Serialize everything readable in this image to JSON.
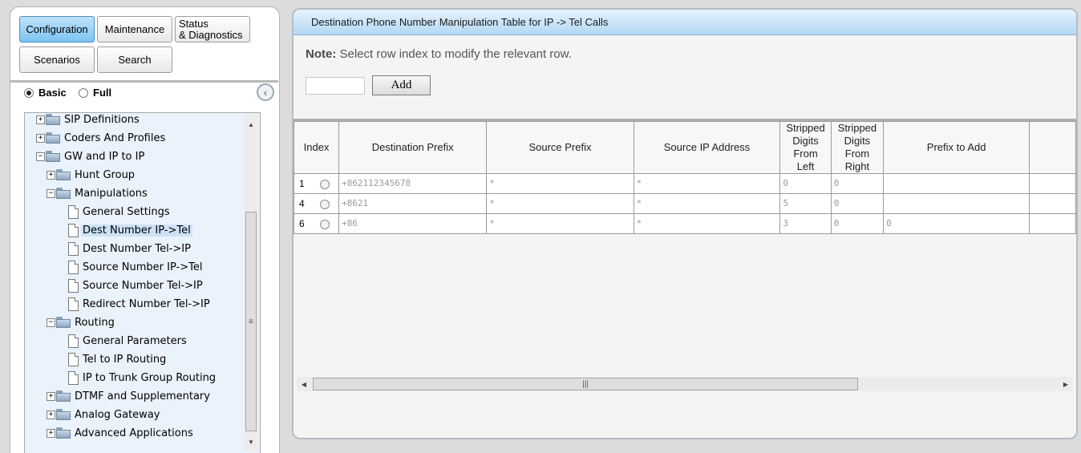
{
  "nav": {
    "configuration": "Configuration",
    "maintenance": "Maintenance",
    "status": "Status\n& Diagnostics",
    "scenarios": "Scenarios",
    "search": "Search"
  },
  "view_toggle": {
    "basic": "Basic",
    "full": "Full",
    "selected": "basic"
  },
  "tree": {
    "items": [
      {
        "label": "SIP Definitions",
        "type": "folder",
        "expander": "+"
      },
      {
        "label": "Coders And Profiles",
        "type": "folder",
        "expander": "+"
      },
      {
        "label": "GW and IP to IP",
        "type": "folder",
        "expander": "−"
      },
      {
        "label": "Hunt Group",
        "type": "folder",
        "expander": "+"
      },
      {
        "label": "Manipulations",
        "type": "folder",
        "expander": "−"
      },
      {
        "label": "General Settings",
        "type": "page"
      },
      {
        "label": "Dest Number IP->Tel",
        "type": "page",
        "selected": true
      },
      {
        "label": "Dest Number Tel->IP",
        "type": "page"
      },
      {
        "label": "Source Number IP->Tel",
        "type": "page"
      },
      {
        "label": "Source Number Tel->IP",
        "type": "page"
      },
      {
        "label": "Redirect Number Tel->IP",
        "type": "page"
      },
      {
        "label": "Routing",
        "type": "folder",
        "expander": "−"
      },
      {
        "label": "General Parameters",
        "type": "page"
      },
      {
        "label": "Tel to IP Routing",
        "type": "page"
      },
      {
        "label": "IP to Trunk Group Routing",
        "type": "page"
      },
      {
        "label": "DTMF and Supplementary",
        "type": "folder",
        "expander": "+"
      },
      {
        "label": "Analog Gateway",
        "type": "folder",
        "expander": "+"
      },
      {
        "label": "Advanced Applications",
        "type": "folder",
        "expander": "+"
      }
    ]
  },
  "panel": {
    "title": "Destination Phone Number Manipulation Table for IP -> Tel Calls",
    "note_label": "Note:",
    "note_text": "Select row index to modify the relevant row.",
    "index_input_value": "",
    "add_label": "Add"
  },
  "table": {
    "columns": [
      "Index",
      "Destination Prefix",
      "Source Prefix",
      "Source IP Address",
      "Stripped\nDigits\nFrom\nLeft",
      "Stripped\nDigits\nFrom\nRight",
      "Prefix to Add",
      ""
    ],
    "rows": [
      {
        "index": "1",
        "dest_prefix": "+862112345678",
        "source_prefix": "*",
        "source_ip": "*",
        "strip_left": "0",
        "strip_right": "0",
        "prefix_to_add": ""
      },
      {
        "index": "4",
        "dest_prefix": "+8621",
        "source_prefix": "*",
        "source_ip": "*",
        "strip_left": "5",
        "strip_right": "0",
        "prefix_to_add": ""
      },
      {
        "index": "6",
        "dest_prefix": "+86",
        "source_prefix": "*",
        "source_ip": "*",
        "strip_left": "3",
        "strip_right": "0",
        "prefix_to_add": "0"
      }
    ]
  },
  "icons": {
    "collapse": "chevron-left-icon",
    "folder": "folder-icon",
    "page": "page-icon"
  },
  "colors": {
    "active_tab": "#7cc3f3",
    "title_bar": "#b2d8f5",
    "tree_bg": "#eaf2fb",
    "selected_item": "#cde2f7"
  }
}
